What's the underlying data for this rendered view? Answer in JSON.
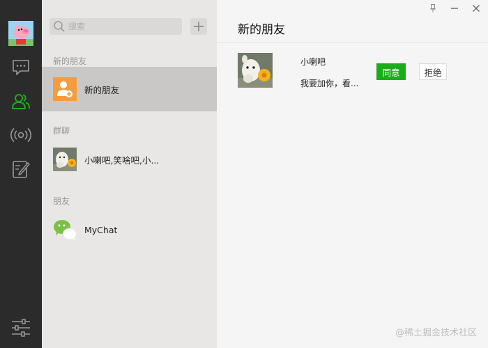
{
  "nav": {
    "avatar_icon": "pig-avatar",
    "items": [
      {
        "icon": "chat-icon",
        "active": false
      },
      {
        "icon": "contacts-icon",
        "active": true
      },
      {
        "icon": "moments-icon",
        "active": false
      },
      {
        "icon": "edit-icon",
        "active": false
      }
    ],
    "settings_icon": "settings-sliders-icon",
    "active_color": "#1aad19",
    "inactive_color": "#9a9a9a"
  },
  "search": {
    "placeholder": "搜索"
  },
  "list": {
    "sections": [
      {
        "label": "新的朋友",
        "rows": [
          {
            "label": "新的朋友",
            "icon": "new-friend-icon",
            "selected": true
          }
        ]
      },
      {
        "label": "群聊",
        "rows": [
          {
            "label": "小喇吧,笑啥吧,小...",
            "icon": "group-avatar",
            "selected": false
          }
        ]
      },
      {
        "label": "朋友",
        "rows": [
          {
            "label": "MyChat",
            "icon": "mychat-logo",
            "selected": false
          }
        ]
      }
    ]
  },
  "panel": {
    "title": "新的朋友",
    "request": {
      "name": "小喇吧",
      "message": "我要加你，看...",
      "accept_label": "同意",
      "reject_label": "拒绝"
    }
  },
  "watermark": "@稀土掘金技术社区"
}
